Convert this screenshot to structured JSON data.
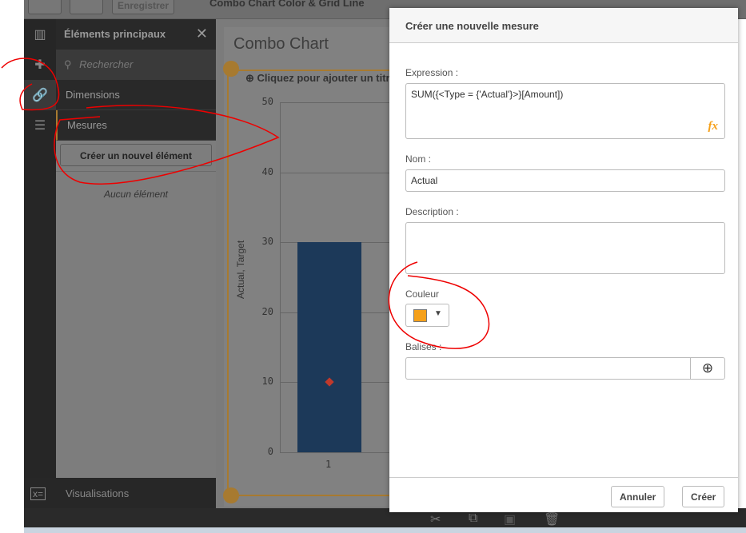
{
  "toolbar": {
    "save_label": "Enregistrer",
    "app_title": "Combo Chart Color & Grid Line"
  },
  "panel": {
    "title": "Éléments principaux",
    "search_placeholder": "Rechercher",
    "items": [
      {
        "label": "Dimensions"
      },
      {
        "label": "Mesures"
      }
    ],
    "create_label": "Créer un nouvel élément",
    "empty_label": "Aucun élément",
    "visualisations_label": "Visualisations"
  },
  "chart": {
    "title": "Combo Chart",
    "subtitle": "Cliquez pour ajouter un titre",
    "ylabel": "Actual, Target",
    "yticks": [
      "50",
      "40",
      "30",
      "20",
      "10",
      "0"
    ],
    "xcategory": "1"
  },
  "chart_data": {
    "type": "bar",
    "categories": [
      "1"
    ],
    "series": [
      {
        "name": "Actual",
        "type": "bar",
        "values": [
          30
        ],
        "color": "#1f3f63"
      },
      {
        "name": "Target",
        "type": "marker",
        "values": [
          10
        ],
        "color": "#c0392b"
      }
    ],
    "ylabel": "Actual, Target",
    "ylim": [
      0,
      50
    ]
  },
  "dialog": {
    "title": "Créer une nouvelle mesure",
    "expression_label": "Expression :",
    "expression_value": "SUM({<Type = {'Actual'}>}[Amount])",
    "name_label": "Nom :",
    "name_value": "Actual",
    "description_label": "Description :",
    "description_value": "",
    "color_label": "Couleur",
    "color_value": "#f5a01a",
    "tags_label": "Balises :",
    "tags_value": "",
    "cancel_label": "Annuler",
    "create_label": "Créer"
  }
}
